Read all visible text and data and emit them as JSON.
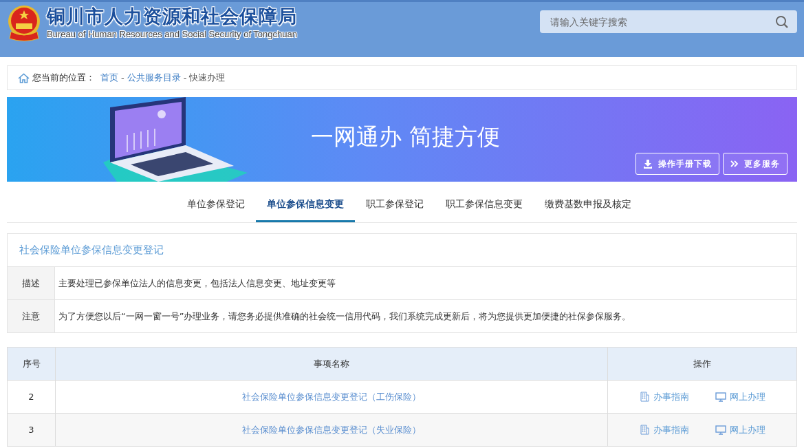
{
  "header": {
    "title": "铜川市人力资源和社会保障局",
    "subtitle": "Bureau of Human Resources and Social Security of Tongchuan",
    "search": {
      "placeholder": "请输入关键字搜索"
    }
  },
  "breadcrumb": {
    "label": "您当前的位置：",
    "separator": "-",
    "items": [
      {
        "text": "首页",
        "kind": "link"
      },
      {
        "text": "公共服务目录",
        "kind": "link"
      },
      {
        "text": "快速办理",
        "kind": "current"
      }
    ]
  },
  "banner": {
    "slogan": "一网通办 简捷方便",
    "buttons": [
      {
        "label": "操作手册下载",
        "kind": "download"
      },
      {
        "label": "更多服务",
        "kind": "more"
      }
    ]
  },
  "tabs": [
    {
      "label": "单位参保登记",
      "selected": false
    },
    {
      "label": "单位参保信息变更",
      "selected": true
    },
    {
      "label": "职工参保登记",
      "selected": false
    },
    {
      "label": "职工参保信息变更",
      "selected": false
    },
    {
      "label": "缴费基数申报及核定",
      "selected": false
    }
  ],
  "info": {
    "title": "社会保险单位参保信息变更登记",
    "rows": [
      {
        "label": "描述",
        "text": "主要处理已参保单位法人的信息变更，包括法人信息变更、地址变更等"
      },
      {
        "label": "注意",
        "text": "为了方便您以后“一网一窗一号”办理业务，请您务必提供准确的社会统一信用代码，我们系统完成更新后，将为您提供更加便捷的社保参保服务。"
      }
    ]
  },
  "table": {
    "columns": [
      "序号",
      "事项名称",
      "操作"
    ],
    "rows": [
      {
        "no": "2",
        "name": "社会保险单位参保信息变更登记（工伤保险）",
        "actions": [
          {
            "label": "办事指南",
            "kind": "guide"
          },
          {
            "label": "网上办理",
            "kind": "online"
          }
        ]
      },
      {
        "no": "3",
        "name": "社会保险单位参保信息变更登记（失业保险）",
        "actions": [
          {
            "label": "办事指南",
            "kind": "guide"
          },
          {
            "label": "网上办理",
            "kind": "online"
          }
        ]
      }
    ]
  }
}
